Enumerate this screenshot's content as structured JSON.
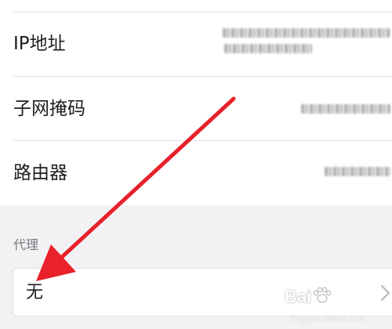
{
  "network_details": {
    "ip_address": {
      "label": "IP地址",
      "value_line1": "fe80::5c4c:7fff:fe3a:b2d1",
      "value_line2": "192.168.1.143"
    },
    "subnet_mask": {
      "label": "子网掩码",
      "value": "255.255.255.0"
    },
    "router": {
      "label": "路由器",
      "value": "192.168.1.1"
    }
  },
  "proxy": {
    "section_title": "代理",
    "value": "无"
  },
  "watermark": {
    "brand": "Bai",
    "domain": "jingyan.baidu.com"
  },
  "colors": {
    "annotation_arrow": "#e8212b",
    "page_background": "#f2f2f4",
    "card_background": "#ffffff",
    "section_title": "#7a7a7f"
  },
  "icons": {
    "proxy_field": "chevron-right-icon",
    "watermark": "paw-icon",
    "annotation": "arrow-icon"
  }
}
